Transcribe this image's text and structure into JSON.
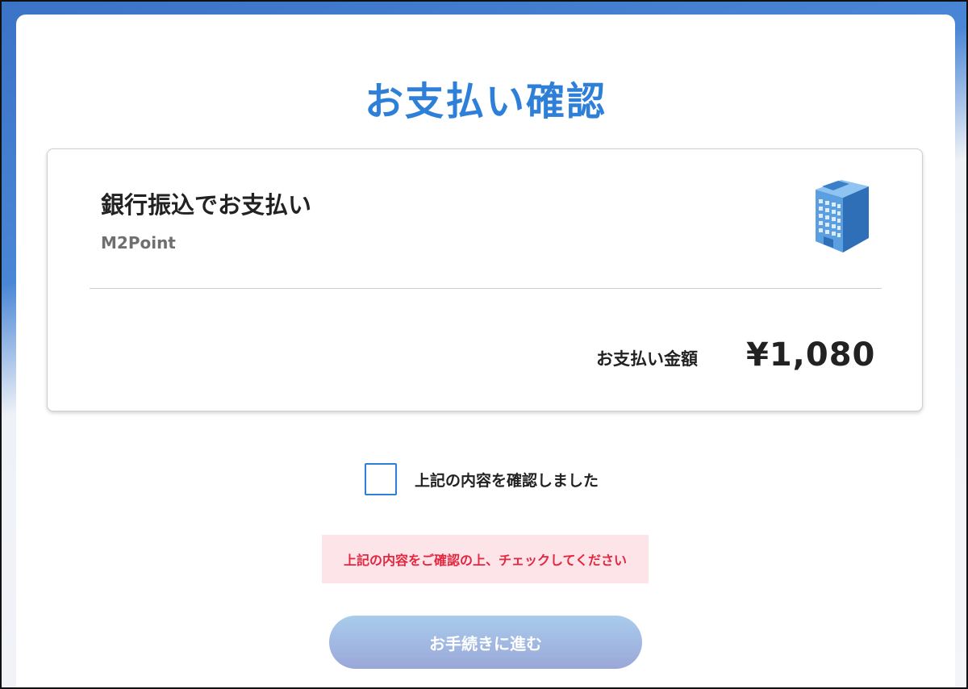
{
  "page": {
    "title": "お支払い確認"
  },
  "payment": {
    "method_title": "銀行振込でお支払い",
    "merchant": "M2Point",
    "method_icon": "bank-building-icon",
    "amount_label": "お支払い金額",
    "amount_value": "¥1,080"
  },
  "confirmation": {
    "checkbox_label": "上記の内容を確認しました",
    "checked": false,
    "error_message": "上記の内容をご確認の上、チェックしてください"
  },
  "actions": {
    "proceed_label": "お手続きに進む",
    "proceed_enabled": false
  },
  "colors": {
    "accent": "#2e7fd8",
    "error_text": "#e5263f",
    "error_background": "#fce4e8"
  }
}
